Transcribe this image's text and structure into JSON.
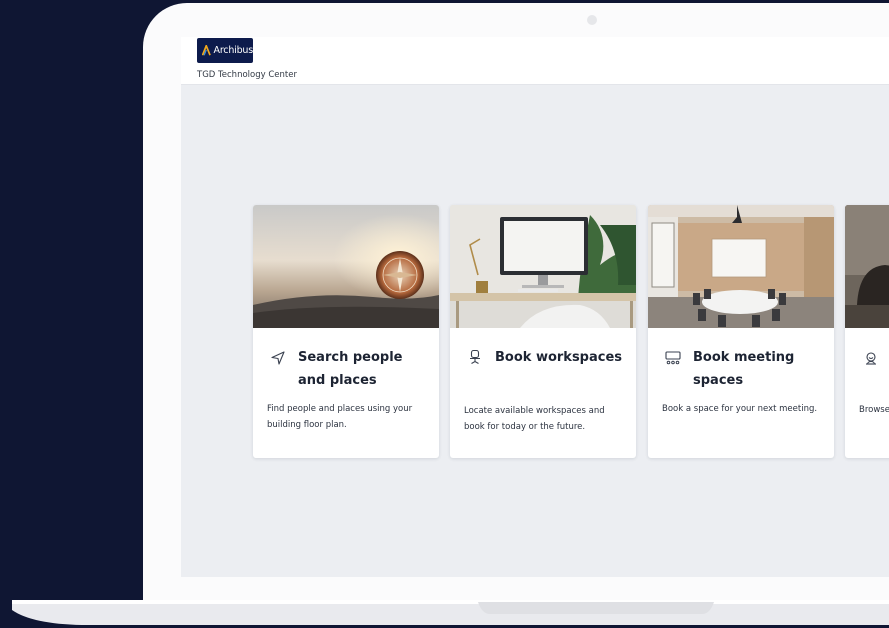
{
  "app": {
    "brand": "Archibus",
    "site_name": "TGD Technology Center",
    "brand_color": "#0d1b4c",
    "accent_color": "#f2a81d"
  },
  "cards": [
    {
      "title": "Search people and places",
      "description": "Find people and places using your building floor plan.",
      "icon": "navigation-arrow-icon"
    },
    {
      "title": "Book workspaces",
      "description": "Locate available workspaces and book for today or the future.",
      "icon": "office-chair-icon"
    },
    {
      "title": "Book meeting spaces",
      "description": "Book a space for your next meeting.",
      "icon": "meeting-room-icon"
    },
    {
      "title": "",
      "description": "Browse",
      "icon": "service-bell-icon"
    }
  ]
}
